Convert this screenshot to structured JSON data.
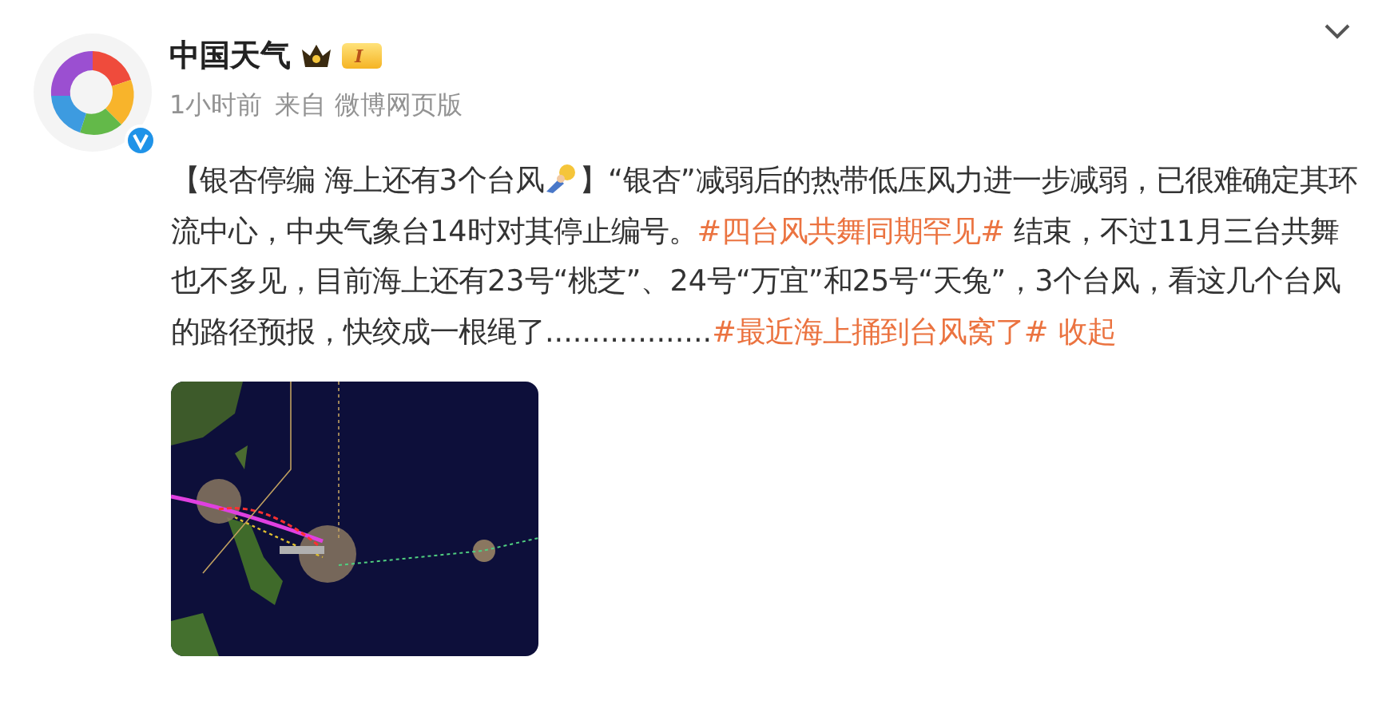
{
  "author": {
    "name": "中国天气",
    "member_badge": "I",
    "verified": true
  },
  "meta": {
    "time": "1小时前",
    "source": "来自 微博网页版"
  },
  "post": {
    "segments": [
      {
        "kind": "text",
        "text": "【银杏停编 海上还有3个台风"
      },
      {
        "kind": "emoji"
      },
      {
        "kind": "text",
        "text": "】“银杏”减弱后的热带低压风力进一步减弱，已很难确定其环流中心，中央气象台14时对其停止编号。"
      },
      {
        "kind": "hashtag",
        "text": "#四台风共舞同期罕见#"
      },
      {
        "kind": "text",
        "text": " 结束，不过11月三台共舞也不多见，目前海上还有23号“桃芝”、24号“万宜”和25号“天兔”，3个台风，看这几个台风的路径预报，快绞成一根绳了.................."
      },
      {
        "kind": "hashtag",
        "text": "#最近海上捅到台风窝了#"
      },
      {
        "kind": "link",
        "text": "收起"
      }
    ]
  }
}
